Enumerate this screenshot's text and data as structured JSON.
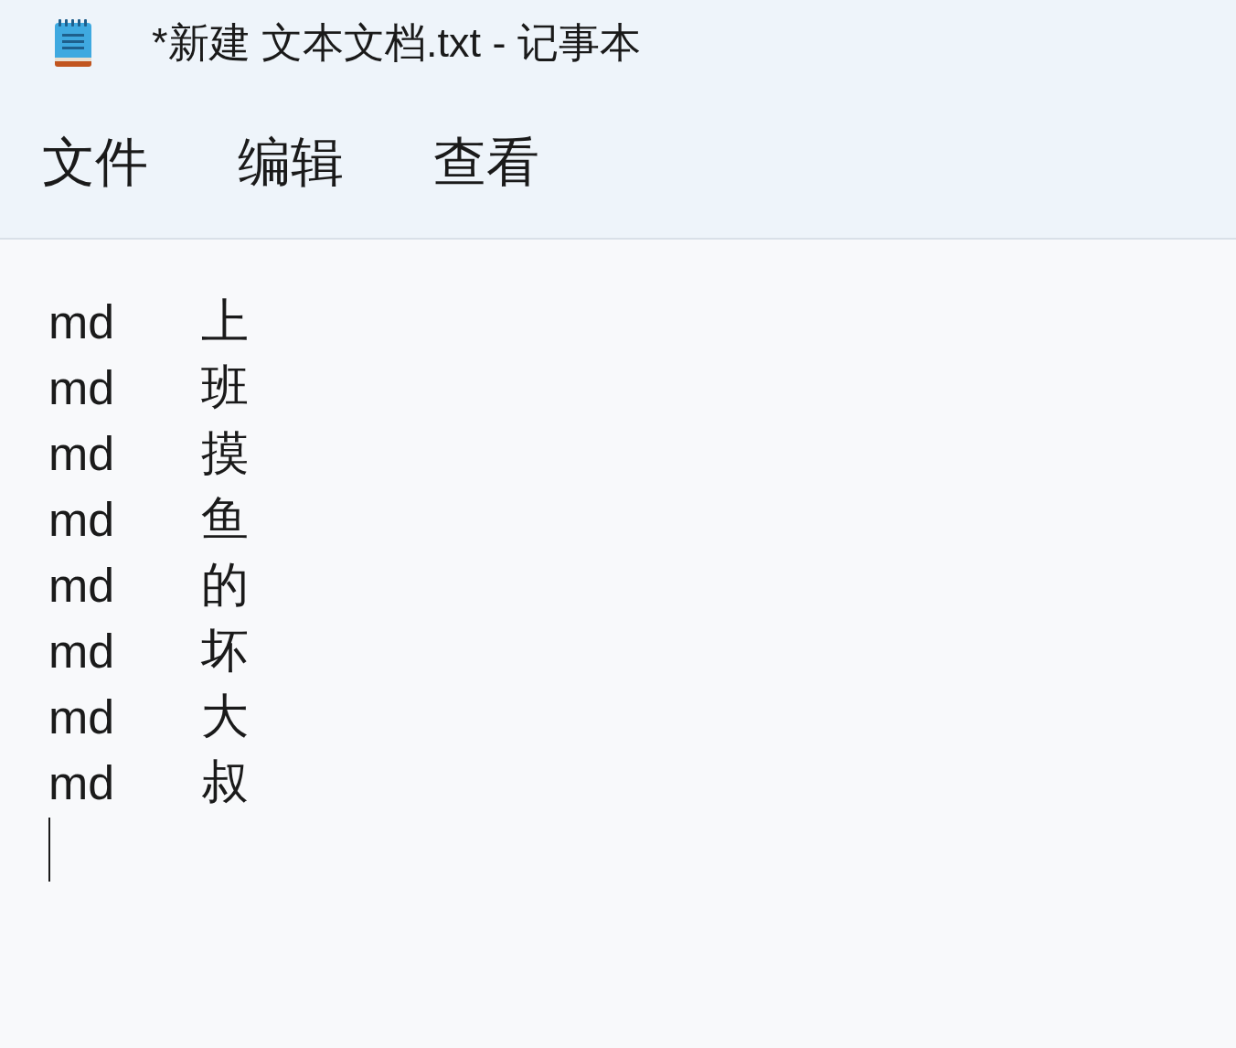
{
  "window": {
    "title": "*新建 文本文档.txt - 记事本"
  },
  "menu": [
    "文件",
    "编辑",
    "查看"
  ],
  "editor": {
    "lines": [
      {
        "left": "md",
        "right": "上"
      },
      {
        "left": "md",
        "right": "班"
      },
      {
        "left": "md",
        "right": "摸"
      },
      {
        "left": "md",
        "right": "鱼"
      },
      {
        "left": "md",
        "right": "的"
      },
      {
        "left": "md",
        "right": "坏"
      },
      {
        "left": "md",
        "right": "大"
      },
      {
        "left": "md",
        "right": "叔"
      }
    ]
  }
}
